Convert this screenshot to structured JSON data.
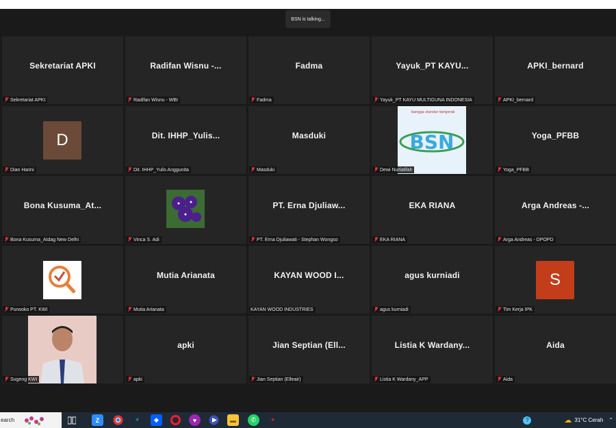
{
  "meeting": {
    "talking": "BSN is talking..."
  },
  "participants": [
    {
      "display": "Sekretariat APKI",
      "label": "Sekretariat APKI"
    },
    {
      "display": "Radifan Wisnu -...",
      "label": "Radifan Wisnu - WBI"
    },
    {
      "display": "Fadma",
      "label": "Fadma"
    },
    {
      "display": "Yayuk_PT KAYU...",
      "label": "Yayuk_PT KAYU MULTIGUNA INDONESIA"
    },
    {
      "display": "APKI_bernard",
      "label": "APKI_bernard"
    },
    {
      "display": "",
      "avatar": "D",
      "avatar_color": "#6b4a3a",
      "label": "Dian Harini"
    },
    {
      "display": "Dit. IHHP_Yulis...",
      "label": "Dit. IHHP_Yulis Anggunita"
    },
    {
      "display": "Masduki",
      "label": "Masduki"
    },
    {
      "display": "",
      "image": "bsn-logo",
      "logo_text": "BSN",
      "logo_caption": "bangga standar bergerak",
      "label": "Dewi Nurlatifah"
    },
    {
      "display": "Yoga_PFBB",
      "label": "Yoga_PFBB"
    },
    {
      "display": "Bona Kusuma_At...",
      "label": "Bona Kusuma_Atdag New Delhi"
    },
    {
      "display": "",
      "image": "purple-flower",
      "label": "Vinca S. Adi"
    },
    {
      "display": "PT. Erna Djuliaw...",
      "label": "PT. Erna Djuliawati - Stephan Wongso"
    },
    {
      "display": "EKA RIANA",
      "label": "EKA RIANA"
    },
    {
      "display": "Arga Andreas -...",
      "label": "Arga Andreas - DPOPD"
    },
    {
      "display": "",
      "image": "kwi-logo",
      "label": "Purwoko PT. KWI"
    },
    {
      "display": "Mutia Arianata",
      "label": "Mutia Arianata"
    },
    {
      "display": "KAYAN WOOD I...",
      "label": "KAYAN WOOD INDUSTRIES",
      "muted": false
    },
    {
      "display": "agus kurniadi",
      "label": "agus kurniadi"
    },
    {
      "display": "",
      "avatar": "S",
      "avatar_color": "#c43d1a",
      "label": "Tim Kerja IPK"
    },
    {
      "display": "",
      "image": "man-photo",
      "label": "Sugeng KWI"
    },
    {
      "display": "apki",
      "label": "apki"
    },
    {
      "display": "Jian Septian (Ell...",
      "label": "Jian Septian (Elleair)"
    },
    {
      "display": "Listia K Wardany...",
      "label": "Listia K Wardany_APP"
    },
    {
      "display": "Aida",
      "label": "Aida"
    }
  ],
  "taskbar": {
    "search": "earch",
    "weather": "31°C  Cerah"
  },
  "colors": {
    "background": "#1a1a1a",
    "tile": "#252525",
    "muted_icon": "#dd3333",
    "taskbar": "#1f2a37"
  }
}
